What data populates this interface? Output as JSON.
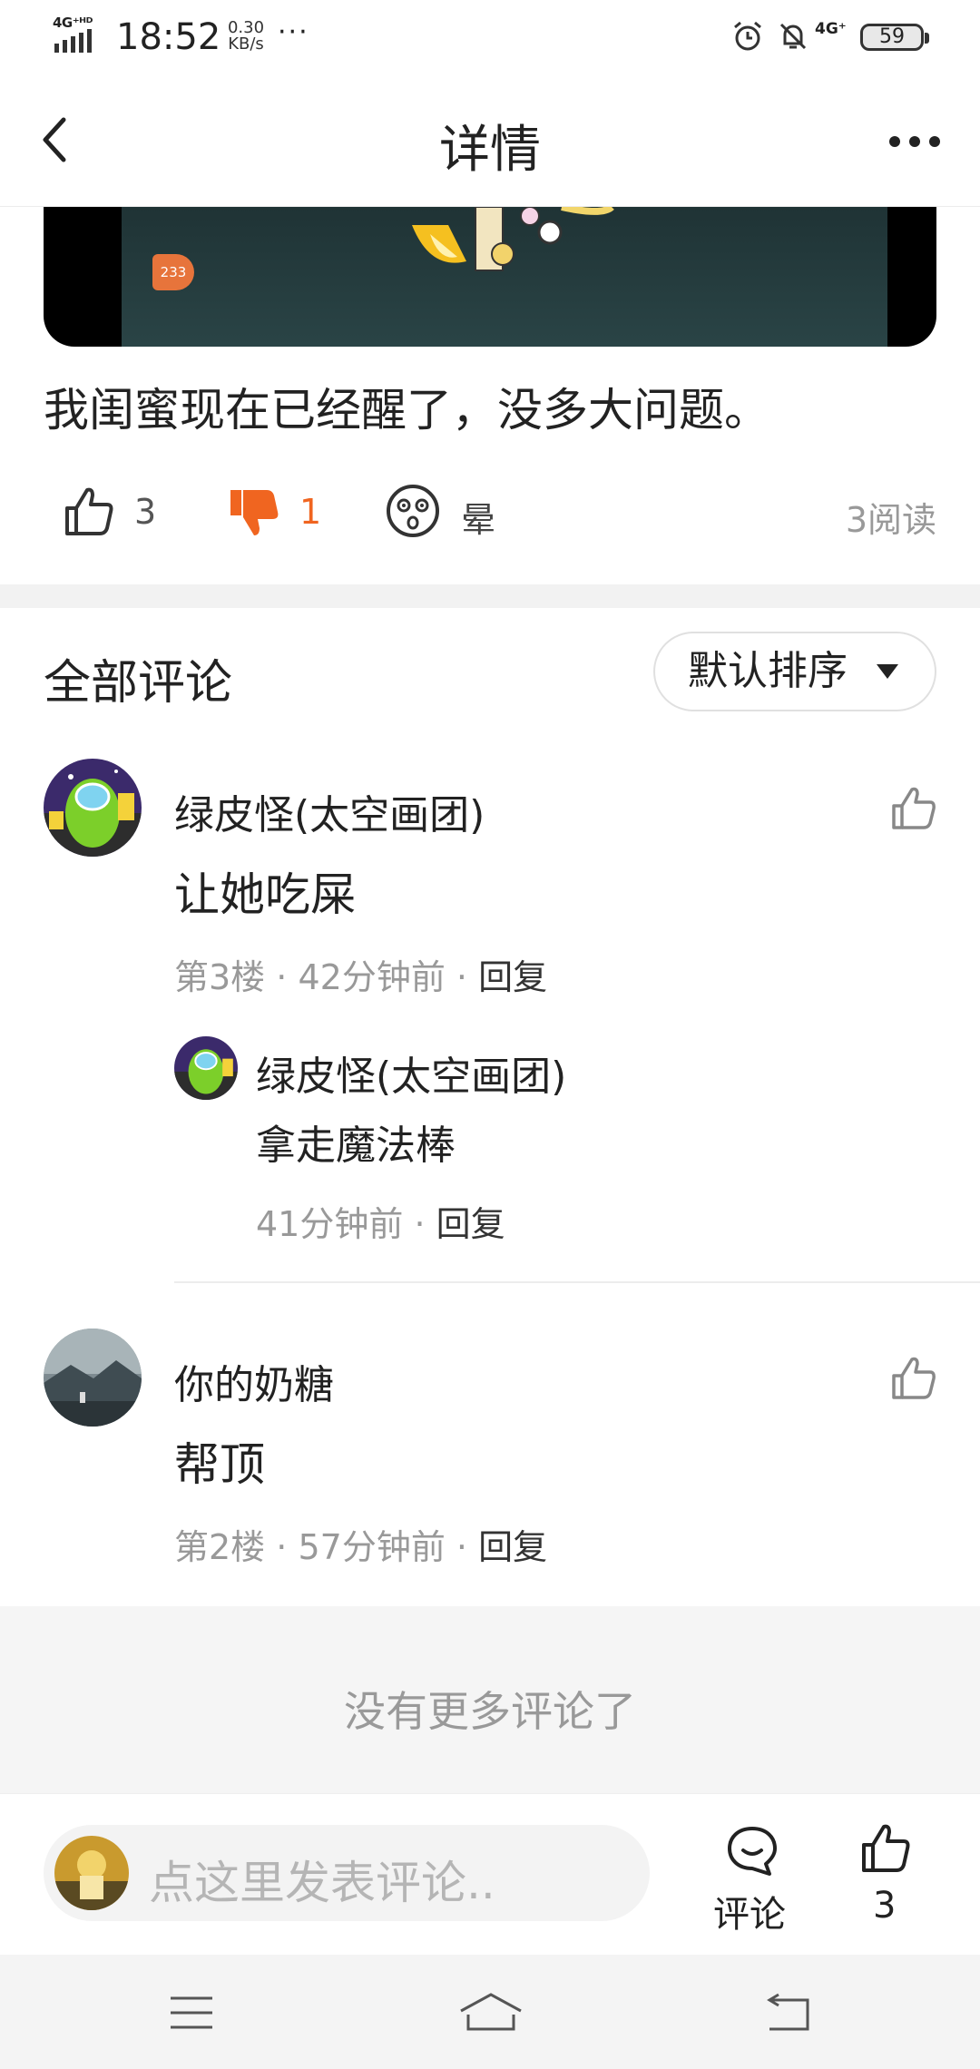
{
  "status_bar": {
    "network_type": "4G⁺ᴴᴰ",
    "time": "18:52",
    "speed_value": "0.30",
    "speed_unit": "KB/s",
    "more": "···",
    "network_right": "4G⁺",
    "battery": "59"
  },
  "header": {
    "title": "详情"
  },
  "video": {
    "badge": "233"
  },
  "post": {
    "text": "我闺蜜现在已经醒了，没多大问题。"
  },
  "reactions": {
    "like_count": "3",
    "dislike_count": "1",
    "dizzy_label": "晕",
    "reads": "3阅读",
    "dislike_color": "#f06520"
  },
  "comments": {
    "title": "全部评论",
    "sort_label": "默认排序",
    "items": [
      {
        "author": "绿皮怪(太空画团)",
        "text": "让她吃屎",
        "floor": "第3楼",
        "time": "42分钟前",
        "reply": "回复",
        "sub_reply": {
          "author": "绿皮怪(太空画团)",
          "text": "拿走魔法棒",
          "time": "41分钟前",
          "reply": "回复"
        }
      },
      {
        "author": "你的奶糖",
        "text": "帮顶",
        "floor": "第2楼",
        "time": "57分钟前",
        "reply": "回复"
      }
    ],
    "no_more": "没有更多评论了"
  },
  "bottom_bar": {
    "input_placeholder": "点这里发表评论..",
    "comment_label": "评论",
    "like_count": "3"
  }
}
